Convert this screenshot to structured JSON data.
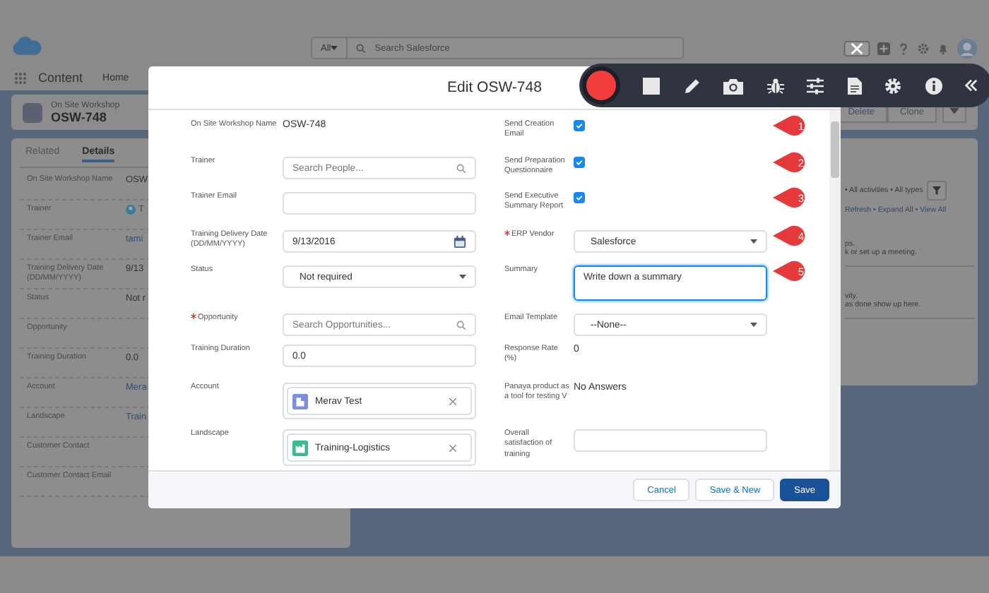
{
  "header": {
    "search_scope": "All",
    "search_placeholder": "Search Salesforce"
  },
  "nav": {
    "app_name": "Content",
    "items": [
      "Home"
    ]
  },
  "record": {
    "type": "On Site Workshop",
    "name": "OSW-748",
    "actions": [
      "Delete",
      "Clone"
    ]
  },
  "detail_tabs": [
    {
      "label": "Related",
      "selected": false
    },
    {
      "label": "Details",
      "selected": true
    }
  ],
  "details": [
    {
      "label": "On Site Workshop Name",
      "value": "OSW",
      "kind": "text"
    },
    {
      "label": "Trainer",
      "value": "T",
      "kind": "user"
    },
    {
      "label": "Trainer Email",
      "value": "tami",
      "kind": "link"
    },
    {
      "label": "Training Delivery Date (DD/MM/YYYY)",
      "value": "9/13",
      "kind": "text"
    },
    {
      "label": "Status",
      "value": "Not r",
      "kind": "text"
    },
    {
      "label": "Opportunity"
    },
    {
      "label": "Training Duration",
      "value": "0.0",
      "kind": "text"
    },
    {
      "label": "Account",
      "value": "Mera",
      "kind": "link"
    },
    {
      "label": "Landscape",
      "value": "Train",
      "kind": "link"
    },
    {
      "label": "Customer Contact"
    },
    {
      "label": "Customer Contact Email"
    }
  ],
  "activity": {
    "filter_text": "• All activities • All types",
    "links": "Refresh • Expand All • View All",
    "messages": [
      [
        "ps.",
        "k or set up a meeting."
      ],
      [
        "vity.",
        "as done show up here."
      ]
    ]
  },
  "modal": {
    "title": "Edit OSW-748",
    "left_fields": [
      {
        "label": "On Site Workshop Name",
        "kind": "text",
        "required": false,
        "value": "OSW-748"
      },
      {
        "label": "Trainer",
        "kind": "search",
        "required": false,
        "placeholder": "Search People..."
      },
      {
        "label": "Trainer Email",
        "kind": "input",
        "required": false
      },
      {
        "label": "Training Delivery Date (DD/MM/YYYY)",
        "kind": "date",
        "required": false,
        "value": "9/13/2016"
      },
      {
        "label": "Status",
        "kind": "select",
        "required": false,
        "value": "Not required"
      },
      {
        "label": "Opportunity",
        "kind": "search",
        "required": true,
        "placeholder": "Search Opportunities..."
      },
      {
        "label": "Training Duration",
        "kind": "input",
        "required": false,
        "value": "0.0"
      },
      {
        "label": "Account",
        "kind": "pill",
        "required": false,
        "value": "Merav Test",
        "icon": {
          "kind": "building",
          "color": "#7f8de1"
        }
      },
      {
        "label": "Landscape",
        "kind": "pill",
        "required": false,
        "value": "Training-Logistics",
        "icon": {
          "kind": "factory",
          "color": "#3bba8f"
        }
      }
    ],
    "right_fields": [
      {
        "label": "Send Creation Email",
        "kind": "checkbox",
        "required": false,
        "checked": true,
        "callout": "1"
      },
      {
        "label": "Send Preparation Questionnaire",
        "kind": "checkbox",
        "required": false,
        "checked": true,
        "callout": "2"
      },
      {
        "label": "Send Executive Summary Report",
        "kind": "checkbox",
        "required": false,
        "checked": true,
        "callout": "3"
      },
      {
        "label": "ERP Vendor",
        "kind": "select",
        "required": true,
        "value": "Salesforce",
        "callout": "4"
      },
      {
        "label": "Summary",
        "kind": "textarea",
        "required": false,
        "value": "Write down a summary",
        "focused": true,
        "callout": "5"
      },
      {
        "label": "Email Template",
        "kind": "select",
        "required": false,
        "value": "--None--"
      },
      {
        "label": "Response Rate (%)",
        "kind": "text",
        "required": false,
        "value": "0"
      },
      {
        "label": "Panaya product as a tool for testing V",
        "kind": "text",
        "required": false,
        "value": "No Answers"
      },
      {
        "label": "Overall satisfaction of training",
        "kind": "input",
        "required": false
      }
    ],
    "buttons": [
      {
        "label": "Cancel",
        "kind": "neutral"
      },
      {
        "label": "Save & New",
        "kind": "neutral"
      },
      {
        "label": "Save",
        "kind": "brand"
      }
    ]
  },
  "toolbar": {
    "recording": true
  }
}
